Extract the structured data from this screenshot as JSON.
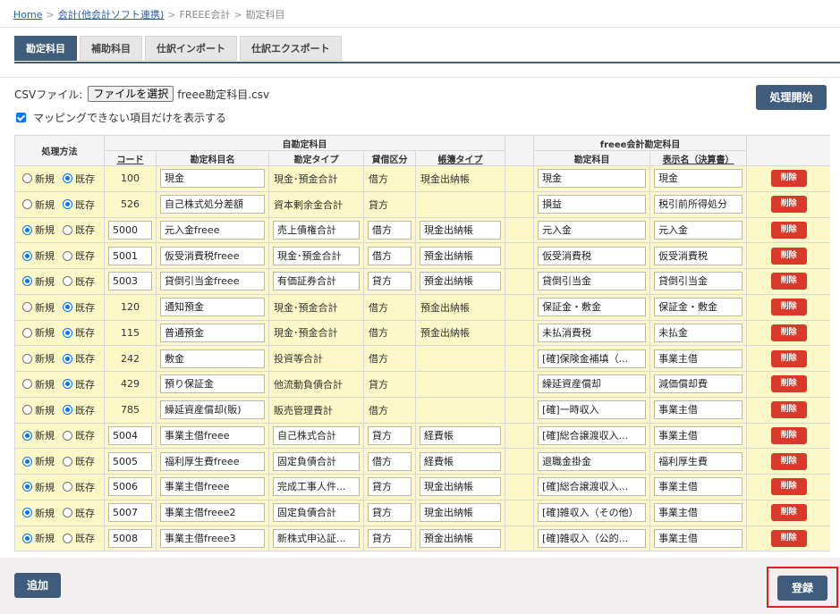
{
  "breadcrumb": {
    "home": "Home",
    "link": "会計(他会計ソフト連携)",
    "freee": "FREEE会計",
    "current": "勘定科目",
    "sep": ">"
  },
  "tabs": [
    {
      "label": "勘定科目",
      "active": true
    },
    {
      "label": "補助科目",
      "active": false
    },
    {
      "label": "仕訳インポート",
      "active": false
    },
    {
      "label": "仕訳エクスポート",
      "active": false
    }
  ],
  "csv": {
    "label": "CSVファイル:",
    "button": "ファイルを選択",
    "file": "freee勘定科目.csv"
  },
  "process_button": "処理開始",
  "mapping_checkbox": {
    "label": "マッピングできない項目だけを表示する",
    "checked": true
  },
  "table": {
    "group_method": "処理方法",
    "group_own": "自勘定科目",
    "group_freee": "freee会計勘定科目",
    "cols": {
      "code": "コード",
      "name": "勘定科目名",
      "type": "勘定タイプ",
      "side": "貸借区分",
      "book": "帳簿タイプ",
      "freee_account": "勘定科目",
      "display": "表示名（決算書）"
    },
    "radio_new": "新規",
    "radio_existing": "既存",
    "delete_label": "削除",
    "rows": [
      {
        "mode": "existing",
        "code": "100",
        "name": "現金",
        "type": "現金･預金合計",
        "side": "借方",
        "book": "現金出納帳",
        "freee": "現金",
        "display": "現金"
      },
      {
        "mode": "existing",
        "code": "526",
        "name": "自己株式処分差額",
        "type": "資本剰余金合計",
        "side": "貸方",
        "book": "",
        "freee": "損益",
        "display": "税引前所得処分"
      },
      {
        "mode": "new",
        "code": "5000",
        "name": "元入金freee",
        "type": "売上債権合計",
        "side": "借方",
        "book": "現金出納帳",
        "freee": "元入金",
        "display": "元入金"
      },
      {
        "mode": "new",
        "code": "5001",
        "name": "仮受消費税freee",
        "type": "現金･預金合計",
        "side": "借方",
        "book": "預金出納帳",
        "freee": "仮受消費税",
        "display": "仮受消費税"
      },
      {
        "mode": "new",
        "code": "5003",
        "name": "貸倒引当金freee",
        "type": "有価証券合計",
        "side": "貸方",
        "book": "預金出納帳",
        "freee": "貸倒引当金",
        "display": "貸倒引当金"
      },
      {
        "mode": "existing",
        "code": "120",
        "name": "通知預金",
        "type": "現金･預金合計",
        "side": "借方",
        "book": "預金出納帳",
        "freee": "保証金・敷金",
        "display": "保証金・敷金"
      },
      {
        "mode": "existing",
        "code": "115",
        "name": "普通預金",
        "type": "現金･預金合計",
        "side": "借方",
        "book": "預金出納帳",
        "freee": "未払消費税",
        "display": "未払金"
      },
      {
        "mode": "existing",
        "code": "242",
        "name": "敷金",
        "type": "投資等合計",
        "side": "借方",
        "book": "",
        "freee": "[確]保険金補填（...",
        "display": "事業主借"
      },
      {
        "mode": "existing",
        "code": "429",
        "name": "預り保証金",
        "type": "他流動負債合計",
        "side": "貸方",
        "book": "",
        "freee": "繰延資産償却",
        "display": "減価償却費"
      },
      {
        "mode": "existing",
        "code": "785",
        "name": "繰延資産償却(販)",
        "type": "販売管理費計",
        "side": "借方",
        "book": "",
        "freee": "[確]一時収入",
        "display": "事業主借"
      },
      {
        "mode": "new",
        "code": "5004",
        "name": "事業主借freee",
        "type": "自己株式合計",
        "side": "貸方",
        "book": "経費帳",
        "freee": "[確]総合譲渡収入...",
        "display": "事業主借"
      },
      {
        "mode": "new",
        "code": "5005",
        "name": "福利厚生費freee",
        "type": "固定負債合計",
        "side": "借方",
        "book": "経費帳",
        "freee": "退職金掛金",
        "display": "福利厚生費"
      },
      {
        "mode": "new",
        "code": "5006",
        "name": "事業主借freee",
        "type": "完成工事人件...",
        "side": "貸方",
        "book": "現金出納帳",
        "freee": "[確]総合譲渡収入...",
        "display": "事業主借"
      },
      {
        "mode": "new",
        "code": "5007",
        "name": "事業主借freee2",
        "type": "固定負債合計",
        "side": "貸方",
        "book": "現金出納帳",
        "freee": "[確]雑収入（その他）",
        "display": "事業主借"
      },
      {
        "mode": "new",
        "code": "5008",
        "name": "事業主借freee3",
        "type": "新株式申込証...",
        "side": "貸方",
        "book": "預金出納帳",
        "freee": "[確]雑収入（公的...",
        "display": "事業主借"
      }
    ]
  },
  "footer": {
    "add": "追加",
    "register": "登録"
  }
}
